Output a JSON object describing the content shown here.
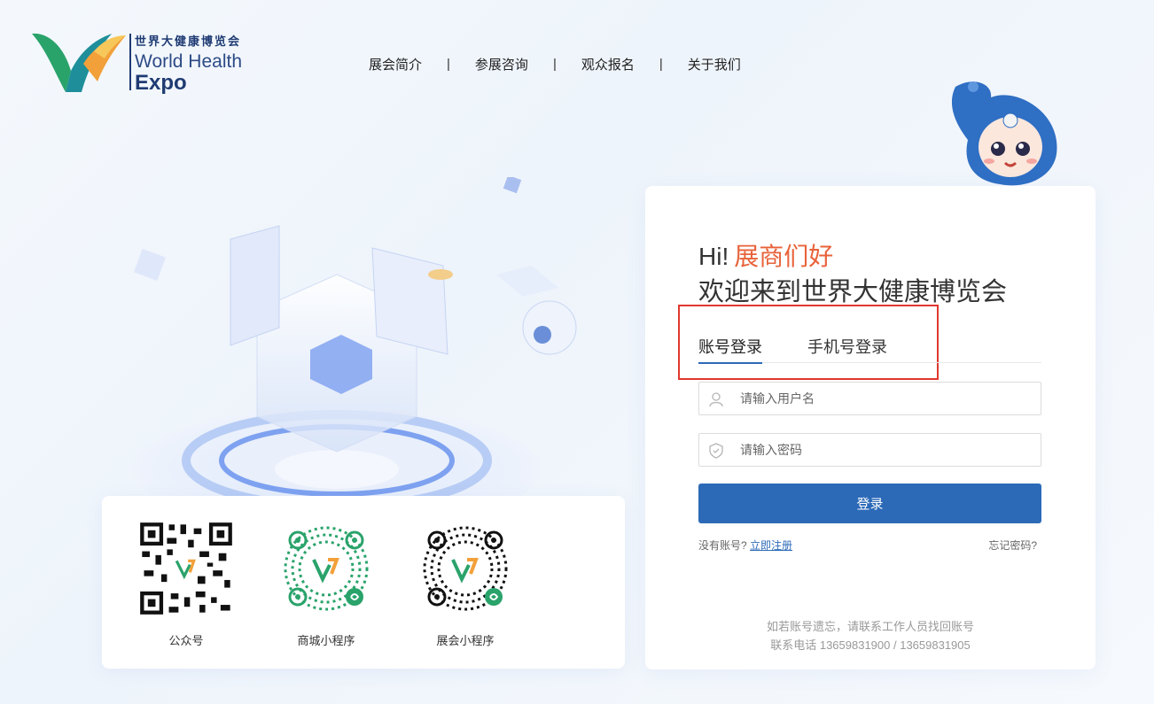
{
  "brand": {
    "name_cn": "世界大健康博览会",
    "name_en_line1": "World Health",
    "name_en_line2": "Expo"
  },
  "nav": {
    "items": [
      "展会简介",
      "参展咨询",
      "观众报名",
      "关于我们"
    ],
    "separator": "|"
  },
  "qr": {
    "items": [
      {
        "label": "公众号"
      },
      {
        "label": "商城小程序"
      },
      {
        "label": "展会小程序"
      }
    ]
  },
  "login": {
    "greeting_hi": "Hi!",
    "greeting_accent": "展商们好",
    "welcome": "欢迎来到世界大健康博览会",
    "tabs": [
      "账号登录",
      "手机号登录"
    ],
    "active_tab": "账号登录",
    "username_placeholder": "请输入用户名",
    "password_placeholder": "请输入密码",
    "submit_label": "登录",
    "no_account_text": "没有账号?",
    "register_link": "立即注册",
    "forgot_link": "忘记密码?",
    "footer_line1": "如若账号遗忘，请联系工作人员找回账号",
    "footer_line2": "联系电话 13659831900 / 13659831905"
  },
  "colors": {
    "primary": "#2c6ab8",
    "accent": "#e8623a",
    "highlight_border": "#e0382f"
  }
}
